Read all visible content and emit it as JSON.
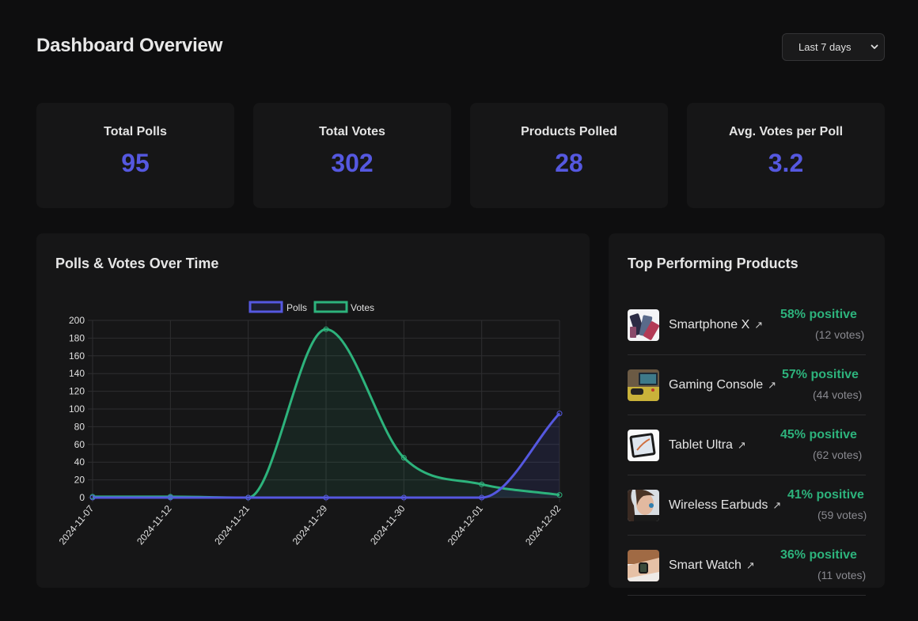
{
  "header": {
    "title": "Dashboard Overview",
    "range_select": {
      "selected": "Last 7 days"
    }
  },
  "stats": [
    {
      "label": "Total Polls",
      "value": "95"
    },
    {
      "label": "Total Votes",
      "value": "302"
    },
    {
      "label": "Products Polled",
      "value": "28"
    },
    {
      "label": "Avg. Votes per Poll",
      "value": "3.2"
    }
  ],
  "chart_panel": {
    "title": "Polls & Votes Over Time"
  },
  "chart_data": {
    "type": "line",
    "title": "Polls & Votes Over Time",
    "x": [
      "2024-11-07",
      "2024-11-12",
      "2024-11-21",
      "2024-11-29",
      "2024-11-30",
      "2024-12-01",
      "2024-12-02"
    ],
    "series": [
      {
        "name": "Polls",
        "color": "#5558e0",
        "values": [
          0,
          0,
          0,
          0,
          0,
          0,
          95
        ]
      },
      {
        "name": "Votes",
        "color": "#2db37c",
        "values": [
          1,
          1,
          0,
          190,
          45,
          15,
          3
        ]
      }
    ],
    "yticks": [
      0,
      20,
      40,
      60,
      80,
      100,
      120,
      140,
      160,
      180,
      200
    ],
    "ylim": [
      0,
      200
    ],
    "xlabel": "",
    "ylabel": "",
    "grid": true,
    "legend": "top-center",
    "filled": true,
    "smooth": true
  },
  "products_panel": {
    "title": "Top Performing Products",
    "items": [
      {
        "name": "Smartphone X",
        "positive": "58% positive",
        "votes": "(12 votes)",
        "thumb": "smartphone"
      },
      {
        "name": "Gaming Console",
        "positive": "57% positive",
        "votes": "(44 votes)",
        "thumb": "console"
      },
      {
        "name": "Tablet Ultra",
        "positive": "45% positive",
        "votes": "(62 votes)",
        "thumb": "tablet"
      },
      {
        "name": "Wireless Earbuds",
        "positive": "41% positive",
        "votes": "(59 votes)",
        "thumb": "earbuds"
      },
      {
        "name": "Smart Watch",
        "positive": "36% positive",
        "votes": "(11 votes)",
        "thumb": "watch"
      }
    ]
  },
  "colors": {
    "accent": "#5558e0",
    "positive": "#2db37c",
    "background": "#0e0e0f",
    "card": "#161617"
  }
}
